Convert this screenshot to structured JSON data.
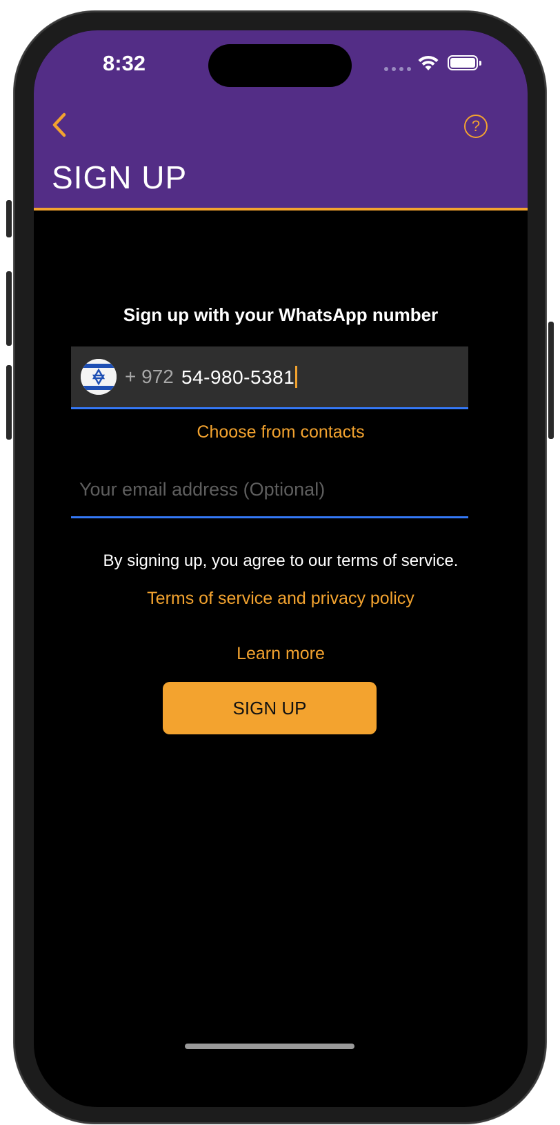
{
  "colors": {
    "header_purple": "#532d86",
    "accent_orange": "#f3a32f",
    "field_underline_blue": "#3478f6",
    "background": "#000000"
  },
  "status_bar": {
    "time": "8:32",
    "icons": [
      "cellular-dots-icon",
      "wifi-icon",
      "battery-icon"
    ]
  },
  "nav": {
    "back_icon": "chevron-left-icon",
    "help_icon": "question-circle-icon",
    "help_glyph": "?",
    "title": "SIGN UP"
  },
  "form": {
    "heading": "Sign up with your WhatsApp number",
    "phone": {
      "flag": "israel-flag-icon",
      "dial_code": "+ 972",
      "value": "54-980-5381"
    },
    "choose_contacts": "Choose from contacts",
    "email_placeholder": "Your email address (Optional)",
    "email_value": ""
  },
  "terms": {
    "text": "By signing up, you agree to our terms of service.",
    "link": "Terms of service and privacy policy",
    "learn_more": "Learn more"
  },
  "submit": {
    "label": "SIGN UP"
  }
}
